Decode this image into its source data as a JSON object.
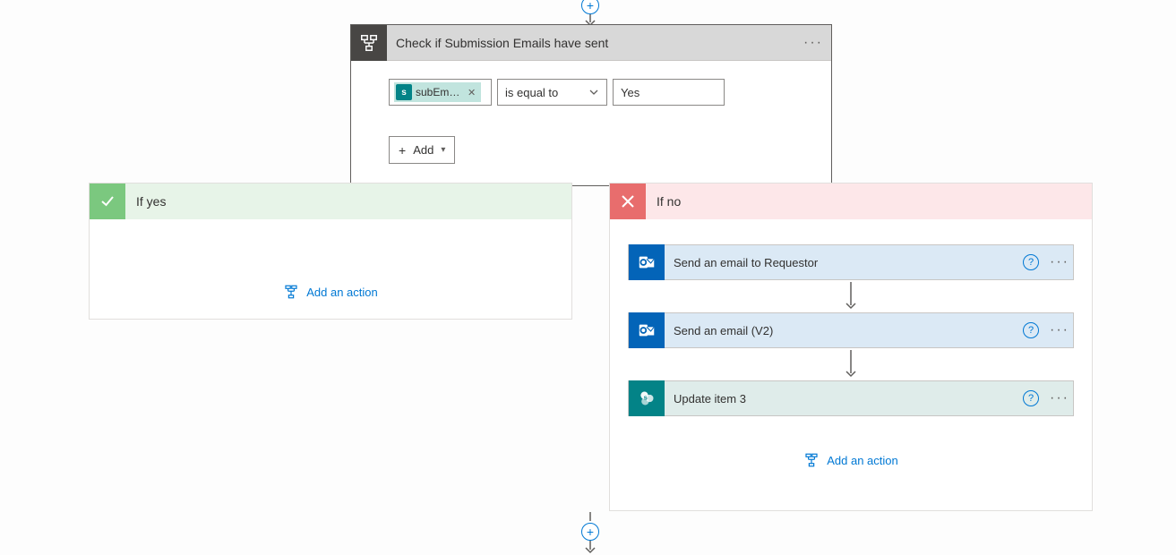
{
  "condition": {
    "title": "Check if Submission Emails have sent",
    "token_label": "subEmail…",
    "operator": "is equal to",
    "value": "Yes",
    "add_label": "Add"
  },
  "branches": {
    "yes": {
      "label": "If yes",
      "add_action": "Add an action"
    },
    "no": {
      "label": "If no",
      "add_action": "Add an action",
      "actions": [
        {
          "title": "Send an email to Requestor",
          "type": "outlook"
        },
        {
          "title": "Send an email (V2)",
          "type": "outlook"
        },
        {
          "title": "Update item 3",
          "type": "sp"
        }
      ]
    }
  }
}
